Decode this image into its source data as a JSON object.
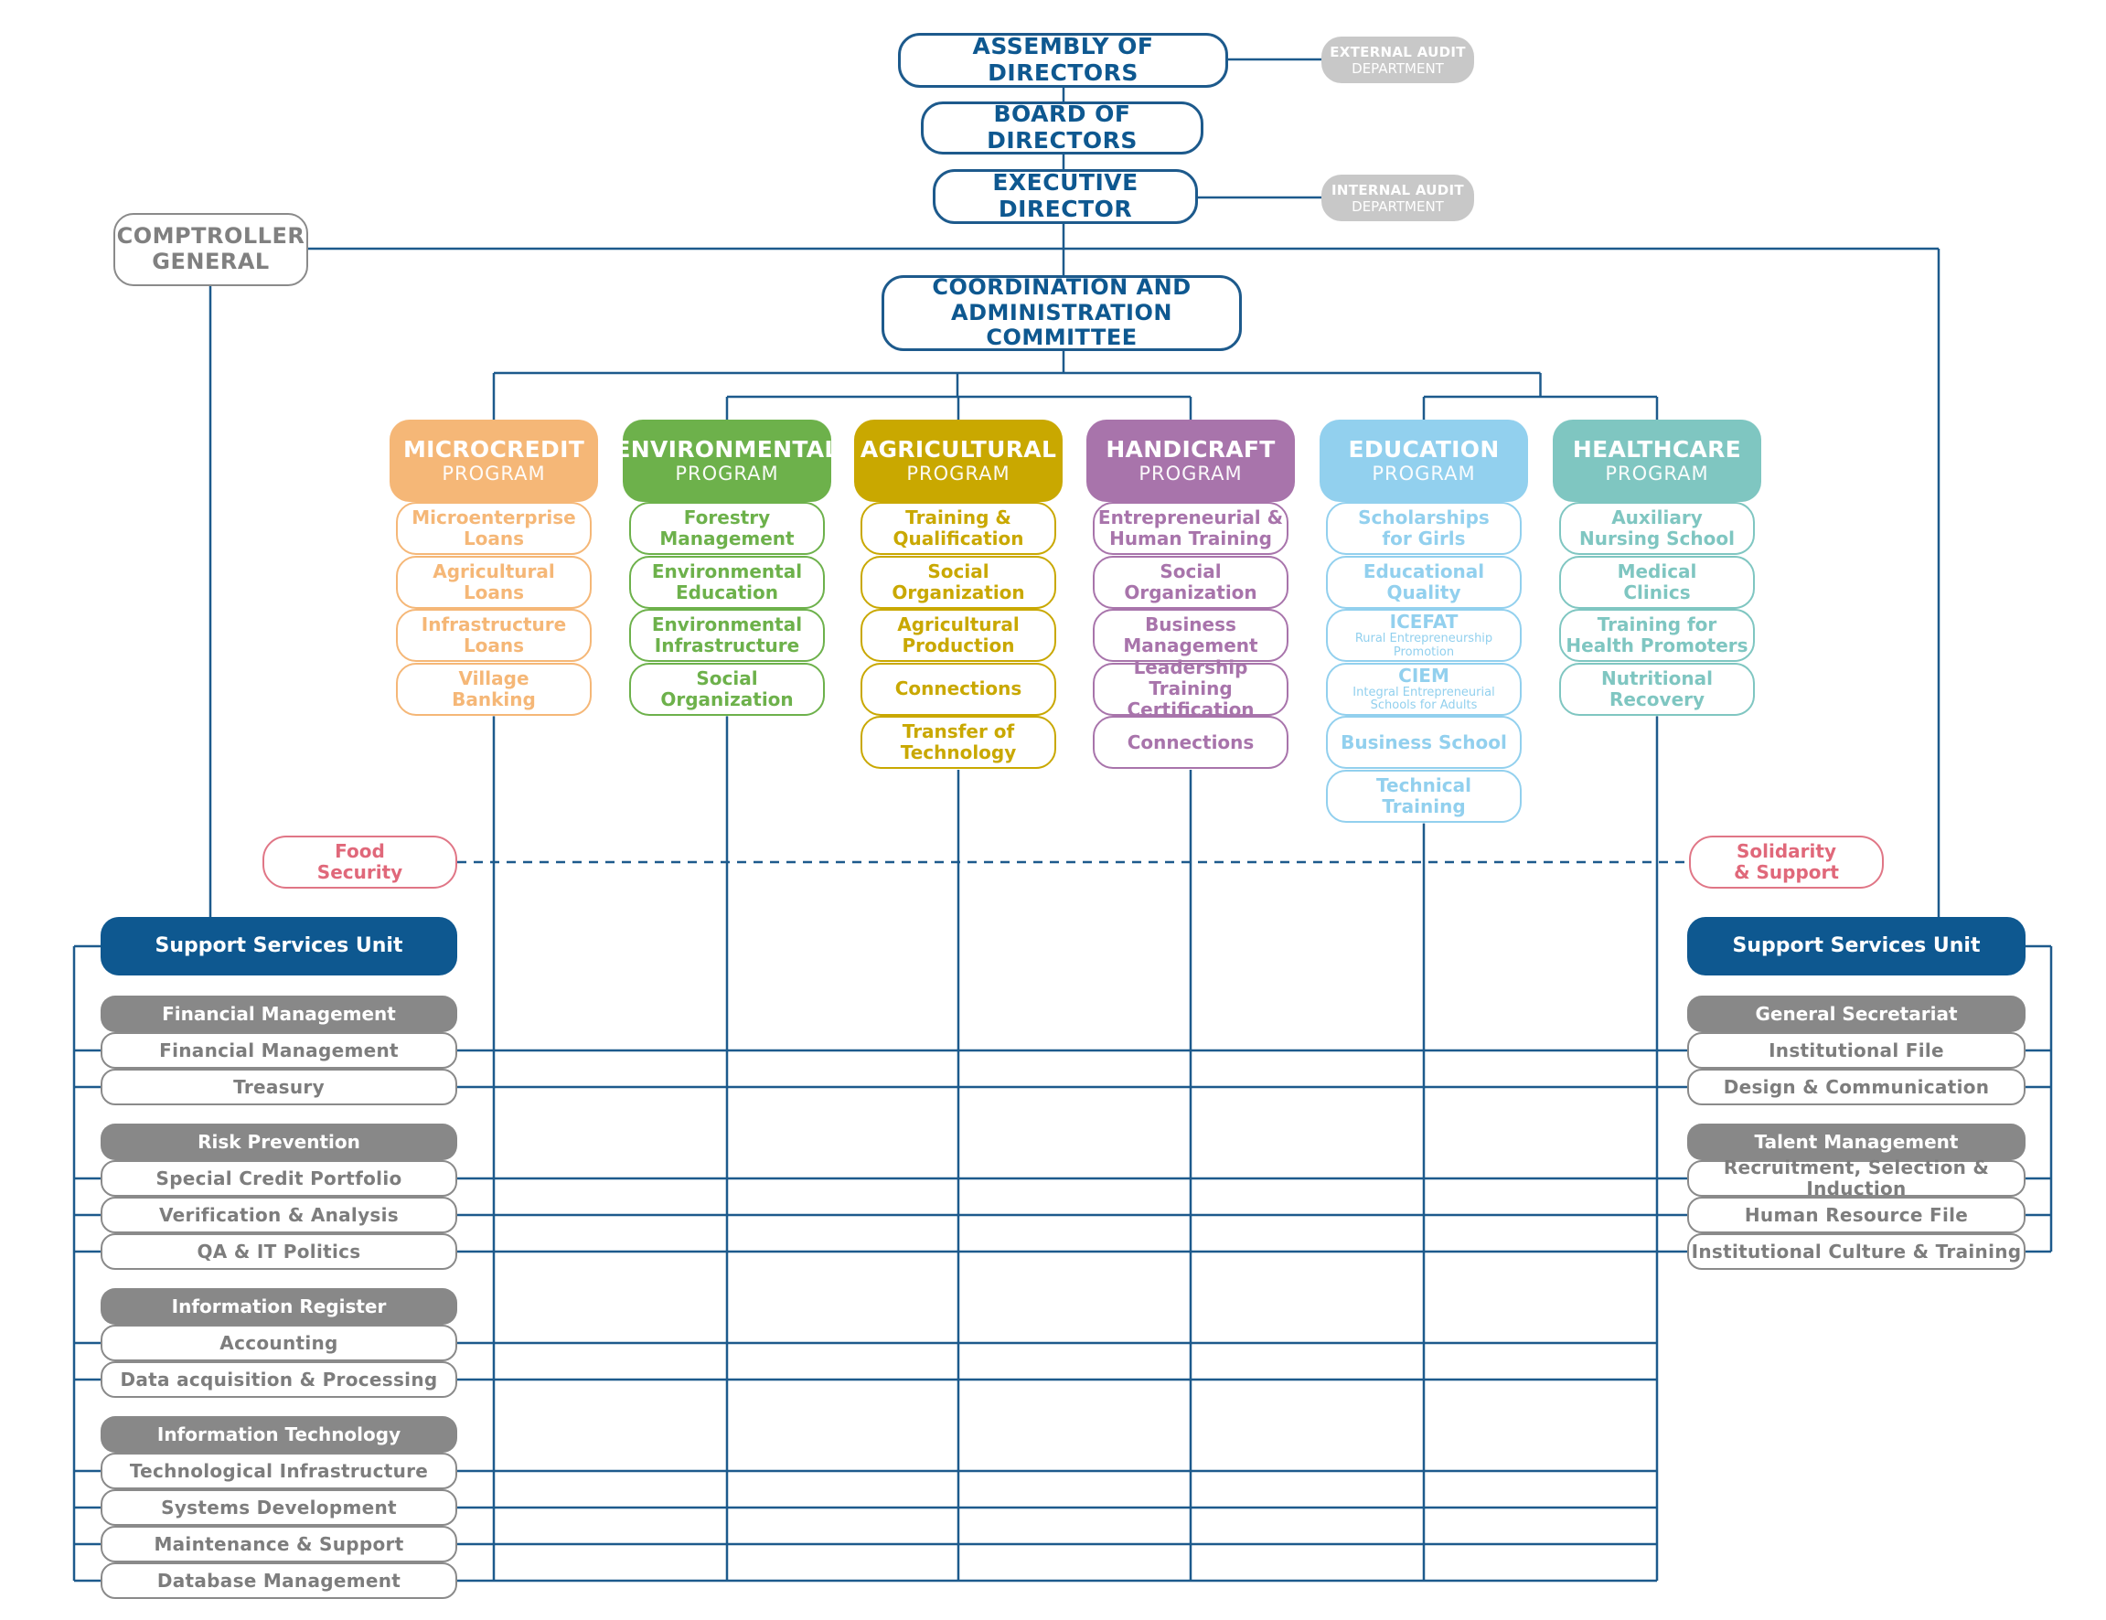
{
  "top": {
    "assembly": "ASSEMBLY OF DIRECTORS",
    "board": "BOARD OF DIRECTORS",
    "executive": "EXECUTIVE DIRECTOR",
    "external_audit": {
      "line1": "EXTERNAL AUDIT",
      "line2": "DEPARTMENT"
    },
    "internal_audit": {
      "line1": "INTERNAL AUDIT",
      "line2": "DEPARTMENT"
    },
    "comptroller": {
      "line1": "COMPTROLLER",
      "line2": "GENERAL"
    },
    "committee": {
      "line1": "COORDINATION AND",
      "line2": "ADMINISTRATION COMMITTEE"
    }
  },
  "colors": {
    "line": "#1d5a8c",
    "microcredit": "#f5b777",
    "environmental": "#6db14b",
    "agricultural": "#c9a800",
    "handicraft": "#a874ab",
    "education": "#92d0ee",
    "healthcare": "#7fc6c1",
    "support": "#0e5890",
    "section": "#888888",
    "pink": "#e0687a"
  },
  "programs": [
    {
      "key": "microcredit",
      "title": "MICROCREDIT",
      "subtitle": "PROGRAM",
      "items": [
        {
          "line1": "Microenterprise",
          "line2": "Loans"
        },
        {
          "line1": "Agricultural",
          "line2": "Loans"
        },
        {
          "line1": "Infrastructure",
          "line2": "Loans"
        },
        {
          "line1": "Village",
          "line2": "Banking"
        }
      ]
    },
    {
      "key": "environmental",
      "title": "ENVIRONMENTAL",
      "subtitle": "PROGRAM",
      "items": [
        {
          "line1": "Forestry",
          "line2": "Management"
        },
        {
          "line1": "Environmental",
          "line2": "Education"
        },
        {
          "line1": "Environmental",
          "line2": "Infrastructure"
        },
        {
          "line1": "Social",
          "line2": "Organization"
        }
      ]
    },
    {
      "key": "agricultural",
      "title": "AGRICULTURAL",
      "subtitle": "PROGRAM",
      "items": [
        {
          "line1": "Training &",
          "line2": "Qualification"
        },
        {
          "line1": "Social",
          "line2": "Organization"
        },
        {
          "line1": "Agricultural",
          "line2": "Production"
        },
        {
          "line1": "Connections",
          "line2": ""
        },
        {
          "line1": "Transfer of",
          "line2": "Technology"
        }
      ]
    },
    {
      "key": "handicraft",
      "title": "HANDICRAFT",
      "subtitle": "PROGRAM",
      "items": [
        {
          "line1": "Entrepreneurial &",
          "line2": "Human Training"
        },
        {
          "line1": "Social",
          "line2": "Organization"
        },
        {
          "line1": "Business",
          "line2": "Management"
        },
        {
          "line1": "Leadership Training",
          "line2": "Certification"
        },
        {
          "line1": "Connections",
          "line2": ""
        }
      ]
    },
    {
      "key": "education",
      "title": "EDUCATION",
      "subtitle": "PROGRAM",
      "items": [
        {
          "line1": "Scholarships",
          "line2": "for Girls"
        },
        {
          "line1": "Educational",
          "line2": "Quality"
        },
        {
          "line1": "ICEFAT",
          "sub1": "Rural Entrepreneurship",
          "sub2": "Promotion"
        },
        {
          "line1": "CIEM",
          "sub1": "Integral Entrepreneurial",
          "sub2": "Schools for Adults"
        },
        {
          "line1": "Business School",
          "line2": ""
        },
        {
          "line1": "Technical",
          "line2": "Training"
        }
      ]
    },
    {
      "key": "healthcare",
      "title": "HEALTHCARE",
      "subtitle": "PROGRAM",
      "items": [
        {
          "line1": "Auxiliary",
          "line2": "Nursing School"
        },
        {
          "line1": "Medical",
          "line2": "Clinics"
        },
        {
          "line1": "Training for",
          "line2": "Health Promoters"
        },
        {
          "line1": "Nutritional",
          "line2": "Recovery"
        }
      ]
    }
  ],
  "food_security": {
    "line1": "Food",
    "line2": "Security"
  },
  "solidarity": {
    "line1": "Solidarity",
    "line2": "& Support"
  },
  "support_left": {
    "title": "Support Services Unit",
    "sections": [
      {
        "title": "Financial Management",
        "items": [
          "Financial Management",
          "Treasury"
        ]
      },
      {
        "title": "Risk Prevention",
        "items": [
          "Special Credit Portfolio",
          "Verification & Analysis",
          "QA & IT Politics"
        ]
      },
      {
        "title": "Information Register",
        "items": [
          "Accounting",
          "Data acquisition & Processing"
        ]
      },
      {
        "title": "Information Technology",
        "items": [
          "Technological Infrastructure",
          "Systems Development",
          "Maintenance & Support",
          "Database Management"
        ]
      }
    ]
  },
  "support_right": {
    "title": "Support Services Unit",
    "sections": [
      {
        "title": "General Secretariat",
        "items": [
          "Institutional File",
          "Design & Communication"
        ]
      },
      {
        "title": "Talent Management",
        "items": [
          "Recruitment, Selection & Induction",
          "Human Resource File",
          "Institutional Culture & Training"
        ]
      }
    ]
  }
}
